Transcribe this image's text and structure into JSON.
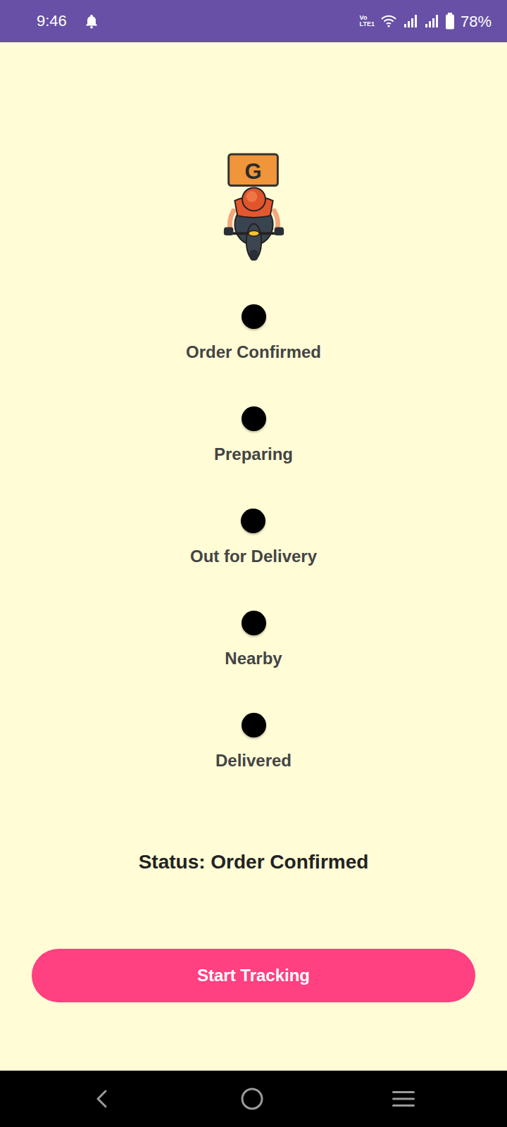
{
  "status_bar": {
    "time": "9:46",
    "volte": [
      "Vo",
      "LTE1"
    ],
    "battery": "78%"
  },
  "rider": {
    "logo": "G"
  },
  "steps": [
    {
      "label": "Order Confirmed"
    },
    {
      "label": "Preparing"
    },
    {
      "label": "Out for Delivery"
    },
    {
      "label": "Nearby"
    },
    {
      "label": "Delivered"
    }
  ],
  "status": "Status: Order Confirmed",
  "buttons": [
    "Start Tracking"
  ]
}
